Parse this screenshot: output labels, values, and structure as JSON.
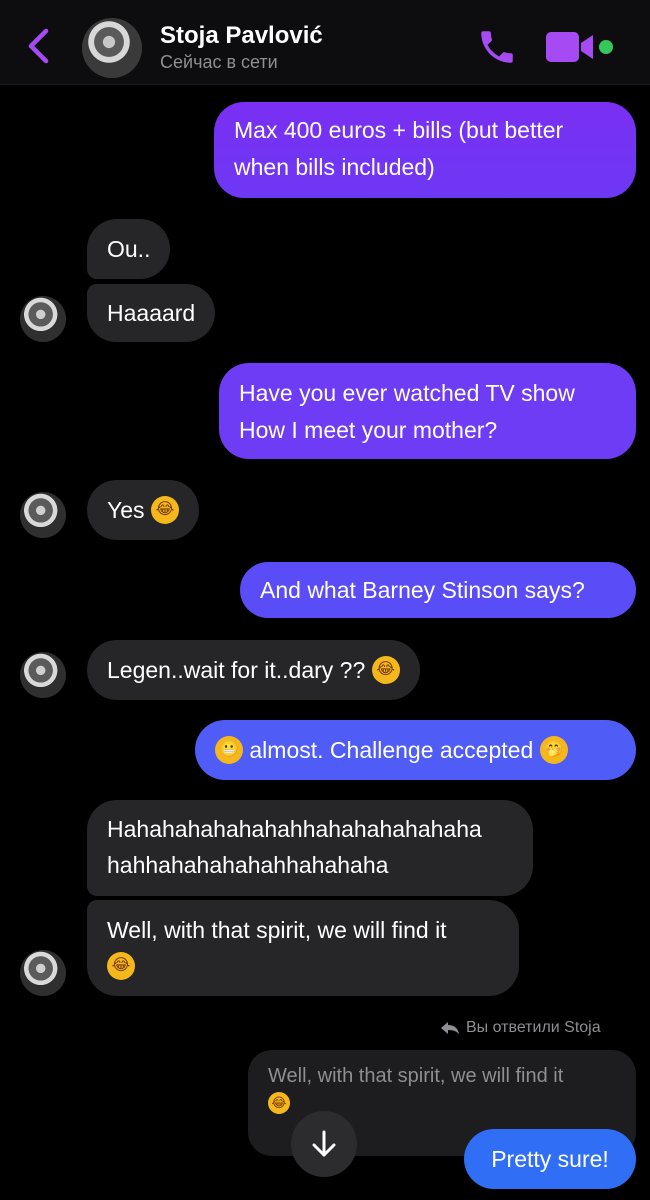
{
  "header": {
    "contact_name": "Stoja Pavlović",
    "status": "Сейчас в сети",
    "accent": "#a64bf4"
  },
  "messages": [
    {
      "dir": "out",
      "lines": [
        "Max 400 euros + bills (but better",
        "when bills included)"
      ]
    },
    {
      "dir": "in",
      "text": "Ou.."
    },
    {
      "dir": "in",
      "text": "Haaaard"
    },
    {
      "dir": "out",
      "lines": [
        "Have you ever watched TV show",
        "How I meet your mother?"
      ]
    },
    {
      "dir": "in",
      "text": "Yes",
      "emoji": "rolling-laughing"
    },
    {
      "dir": "out",
      "text": "And what Barney Stinson says?"
    },
    {
      "dir": "in",
      "text": "Legen..wait for it..dary ??",
      "emoji": "rolling-laughing"
    },
    {
      "dir": "out",
      "text": "almost. Challenge accepted",
      "emoji_before": "grimacing",
      "emoji_after": "hand-over-mouth"
    },
    {
      "dir": "in",
      "lines": [
        "Hahahahahahahahhahahahahahaha",
        "hahhahahahahahhahahaha"
      ]
    },
    {
      "dir": "in",
      "line1": "Well, with that spirit, we will find it",
      "emoji": "rolling-laughing"
    }
  ],
  "reply": {
    "note": "Вы ответили Stoja",
    "quoted": "Well, with that spirit, we will find it",
    "text": "Pretty sure!"
  }
}
